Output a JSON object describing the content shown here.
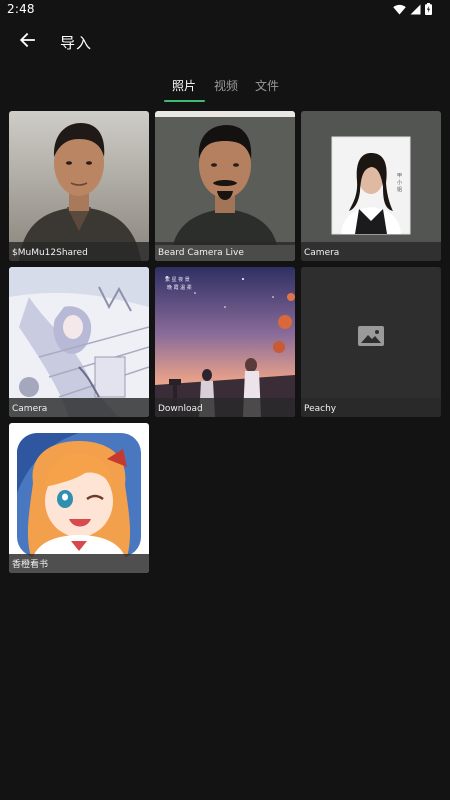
{
  "status_bar": {
    "time": "2:48"
  },
  "header": {
    "title": "导入"
  },
  "tabs": [
    {
      "label": "照片",
      "active": true
    },
    {
      "label": "视频",
      "active": false
    },
    {
      "label": "文件",
      "active": false
    }
  ],
  "albums": [
    {
      "name": "$MuMu12Shared"
    },
    {
      "name": "Beard Camera Live"
    },
    {
      "name": "Camera"
    },
    {
      "name": "Camera"
    },
    {
      "name": "Download"
    },
    {
      "name": "Peachy"
    },
    {
      "name": "香橙看书"
    }
  ],
  "colors": {
    "background": "#131313",
    "accent": "#3dbb73",
    "tab_inactive": "#9a9a9a"
  }
}
